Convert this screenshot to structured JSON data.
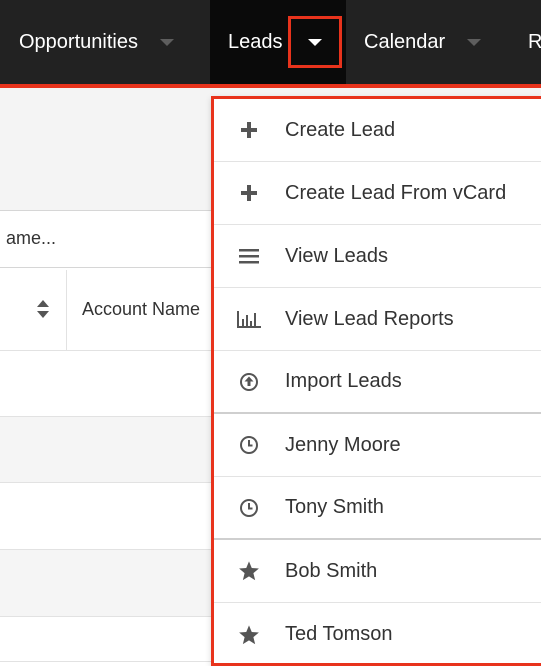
{
  "nav": {
    "items": [
      {
        "label": "Opportunities"
      },
      {
        "label": "Leads"
      },
      {
        "label": "Calendar"
      },
      {
        "label": "R"
      }
    ]
  },
  "page": {
    "search_text": "ame...",
    "column_header": "Account Name"
  },
  "menu": {
    "items": [
      {
        "label": "Create Lead",
        "icon": "plus-icon"
      },
      {
        "label": "Create Lead From vCard",
        "icon": "plus-icon"
      },
      {
        "label": "View Leads",
        "icon": "list-icon"
      },
      {
        "label": "View Lead Reports",
        "icon": "bar-chart-icon"
      },
      {
        "label": "Import Leads",
        "icon": "upload-circle-icon"
      },
      {
        "label": "Jenny Moore",
        "icon": "clock-icon"
      },
      {
        "label": "Tony Smith",
        "icon": "clock-icon"
      },
      {
        "label": "Bob Smith",
        "icon": "star-icon"
      },
      {
        "label": "Ted Tomson",
        "icon": "star-icon"
      }
    ]
  },
  "colors": {
    "accent": "#e8331c",
    "nav_bg": "#222222",
    "icon": "#555555"
  }
}
